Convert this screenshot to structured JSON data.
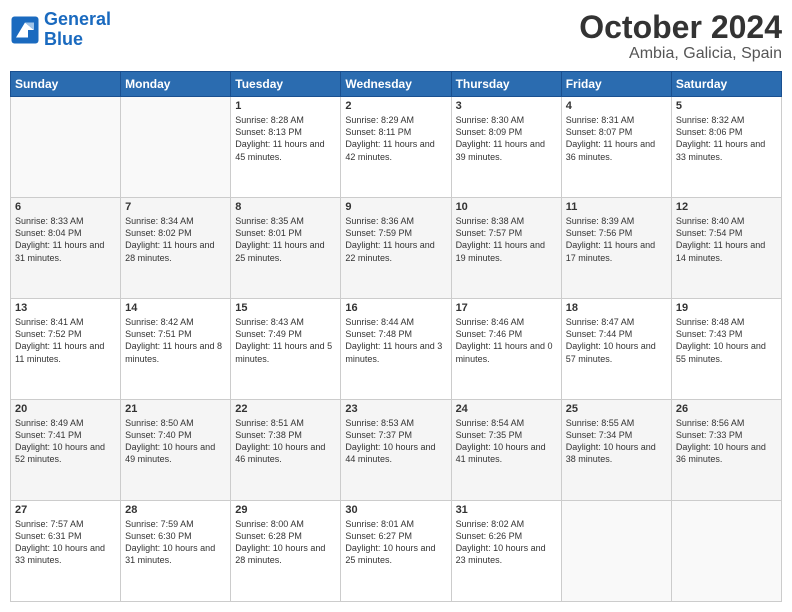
{
  "header": {
    "logo_line1": "General",
    "logo_line2": "Blue",
    "title": "October 2024",
    "subtitle": "Ambia, Galicia, Spain"
  },
  "days_of_week": [
    "Sunday",
    "Monday",
    "Tuesday",
    "Wednesday",
    "Thursday",
    "Friday",
    "Saturday"
  ],
  "weeks": [
    [
      {
        "day": "",
        "content": ""
      },
      {
        "day": "",
        "content": ""
      },
      {
        "day": "1",
        "content": "Sunrise: 8:28 AM\nSunset: 8:13 PM\nDaylight: 11 hours and 45 minutes."
      },
      {
        "day": "2",
        "content": "Sunrise: 8:29 AM\nSunset: 8:11 PM\nDaylight: 11 hours and 42 minutes."
      },
      {
        "day": "3",
        "content": "Sunrise: 8:30 AM\nSunset: 8:09 PM\nDaylight: 11 hours and 39 minutes."
      },
      {
        "day": "4",
        "content": "Sunrise: 8:31 AM\nSunset: 8:07 PM\nDaylight: 11 hours and 36 minutes."
      },
      {
        "day": "5",
        "content": "Sunrise: 8:32 AM\nSunset: 8:06 PM\nDaylight: 11 hours and 33 minutes."
      }
    ],
    [
      {
        "day": "6",
        "content": "Sunrise: 8:33 AM\nSunset: 8:04 PM\nDaylight: 11 hours and 31 minutes."
      },
      {
        "day": "7",
        "content": "Sunrise: 8:34 AM\nSunset: 8:02 PM\nDaylight: 11 hours and 28 minutes."
      },
      {
        "day": "8",
        "content": "Sunrise: 8:35 AM\nSunset: 8:01 PM\nDaylight: 11 hours and 25 minutes."
      },
      {
        "day": "9",
        "content": "Sunrise: 8:36 AM\nSunset: 7:59 PM\nDaylight: 11 hours and 22 minutes."
      },
      {
        "day": "10",
        "content": "Sunrise: 8:38 AM\nSunset: 7:57 PM\nDaylight: 11 hours and 19 minutes."
      },
      {
        "day": "11",
        "content": "Sunrise: 8:39 AM\nSunset: 7:56 PM\nDaylight: 11 hours and 17 minutes."
      },
      {
        "day": "12",
        "content": "Sunrise: 8:40 AM\nSunset: 7:54 PM\nDaylight: 11 hours and 14 minutes."
      }
    ],
    [
      {
        "day": "13",
        "content": "Sunrise: 8:41 AM\nSunset: 7:52 PM\nDaylight: 11 hours and 11 minutes."
      },
      {
        "day": "14",
        "content": "Sunrise: 8:42 AM\nSunset: 7:51 PM\nDaylight: 11 hours and 8 minutes."
      },
      {
        "day": "15",
        "content": "Sunrise: 8:43 AM\nSunset: 7:49 PM\nDaylight: 11 hours and 5 minutes."
      },
      {
        "day": "16",
        "content": "Sunrise: 8:44 AM\nSunset: 7:48 PM\nDaylight: 11 hours and 3 minutes."
      },
      {
        "day": "17",
        "content": "Sunrise: 8:46 AM\nSunset: 7:46 PM\nDaylight: 11 hours and 0 minutes."
      },
      {
        "day": "18",
        "content": "Sunrise: 8:47 AM\nSunset: 7:44 PM\nDaylight: 10 hours and 57 minutes."
      },
      {
        "day": "19",
        "content": "Sunrise: 8:48 AM\nSunset: 7:43 PM\nDaylight: 10 hours and 55 minutes."
      }
    ],
    [
      {
        "day": "20",
        "content": "Sunrise: 8:49 AM\nSunset: 7:41 PM\nDaylight: 10 hours and 52 minutes."
      },
      {
        "day": "21",
        "content": "Sunrise: 8:50 AM\nSunset: 7:40 PM\nDaylight: 10 hours and 49 minutes."
      },
      {
        "day": "22",
        "content": "Sunrise: 8:51 AM\nSunset: 7:38 PM\nDaylight: 10 hours and 46 minutes."
      },
      {
        "day": "23",
        "content": "Sunrise: 8:53 AM\nSunset: 7:37 PM\nDaylight: 10 hours and 44 minutes."
      },
      {
        "day": "24",
        "content": "Sunrise: 8:54 AM\nSunset: 7:35 PM\nDaylight: 10 hours and 41 minutes."
      },
      {
        "day": "25",
        "content": "Sunrise: 8:55 AM\nSunset: 7:34 PM\nDaylight: 10 hours and 38 minutes."
      },
      {
        "day": "26",
        "content": "Sunrise: 8:56 AM\nSunset: 7:33 PM\nDaylight: 10 hours and 36 minutes."
      }
    ],
    [
      {
        "day": "27",
        "content": "Sunrise: 7:57 AM\nSunset: 6:31 PM\nDaylight: 10 hours and 33 minutes."
      },
      {
        "day": "28",
        "content": "Sunrise: 7:59 AM\nSunset: 6:30 PM\nDaylight: 10 hours and 31 minutes."
      },
      {
        "day": "29",
        "content": "Sunrise: 8:00 AM\nSunset: 6:28 PM\nDaylight: 10 hours and 28 minutes."
      },
      {
        "day": "30",
        "content": "Sunrise: 8:01 AM\nSunset: 6:27 PM\nDaylight: 10 hours and 25 minutes."
      },
      {
        "day": "31",
        "content": "Sunrise: 8:02 AM\nSunset: 6:26 PM\nDaylight: 10 hours and 23 minutes."
      },
      {
        "day": "",
        "content": ""
      },
      {
        "day": "",
        "content": ""
      }
    ]
  ]
}
